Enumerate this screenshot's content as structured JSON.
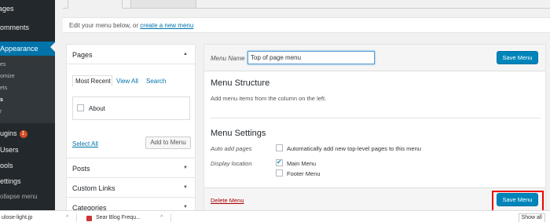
{
  "sidebar": {
    "pages": "ages",
    "comments": "omments",
    "appearance": "Appearance",
    "sub": [
      "es",
      "omize",
      "ets",
      "s",
      "r"
    ],
    "plugins": "ugins",
    "plugins_count": "1",
    "users": "Users",
    "tools": "ools",
    "settings": "ettings",
    "collapse": "ollapse menu"
  },
  "manage": {
    "text": "Edit your menu below, or",
    "link": "create a new menu"
  },
  "accordion": {
    "pages_title": "Pages",
    "tabs": [
      "Most Recent",
      "View All",
      "Search"
    ],
    "items": [
      "About"
    ],
    "select_all": "Select All",
    "add_button": "Add to Menu",
    "posts": "Posts",
    "custom_links": "Custom Links",
    "categories": "Categories"
  },
  "menu": {
    "name_label": "Menu Name",
    "name_value": "Top of page menu",
    "save_label": "Save Menu",
    "structure_title": "Menu Structure",
    "structure_desc": "Add menu items from the column on the left.",
    "settings_title": "Menu Settings",
    "auto_add_label": "Auto add pages",
    "auto_add_text": "Automatically add new top-level pages to this menu",
    "display_label": "Display location",
    "locations": [
      {
        "name": "Main Menu",
        "checked": true
      },
      {
        "name": "Footer Menu",
        "checked": false
      }
    ],
    "delete_label": "Delete Menu"
  },
  "taskbar": {
    "item1": "ulose-light.jp",
    "item2": "Sear Blog Frequ...",
    "show_all": "Show all"
  },
  "colors": {
    "sidebar_bg": "#23282d",
    "accent": "#0073aa",
    "primary_button": "#0085ba",
    "delete": "#a00",
    "highlight_box": "#e00"
  }
}
